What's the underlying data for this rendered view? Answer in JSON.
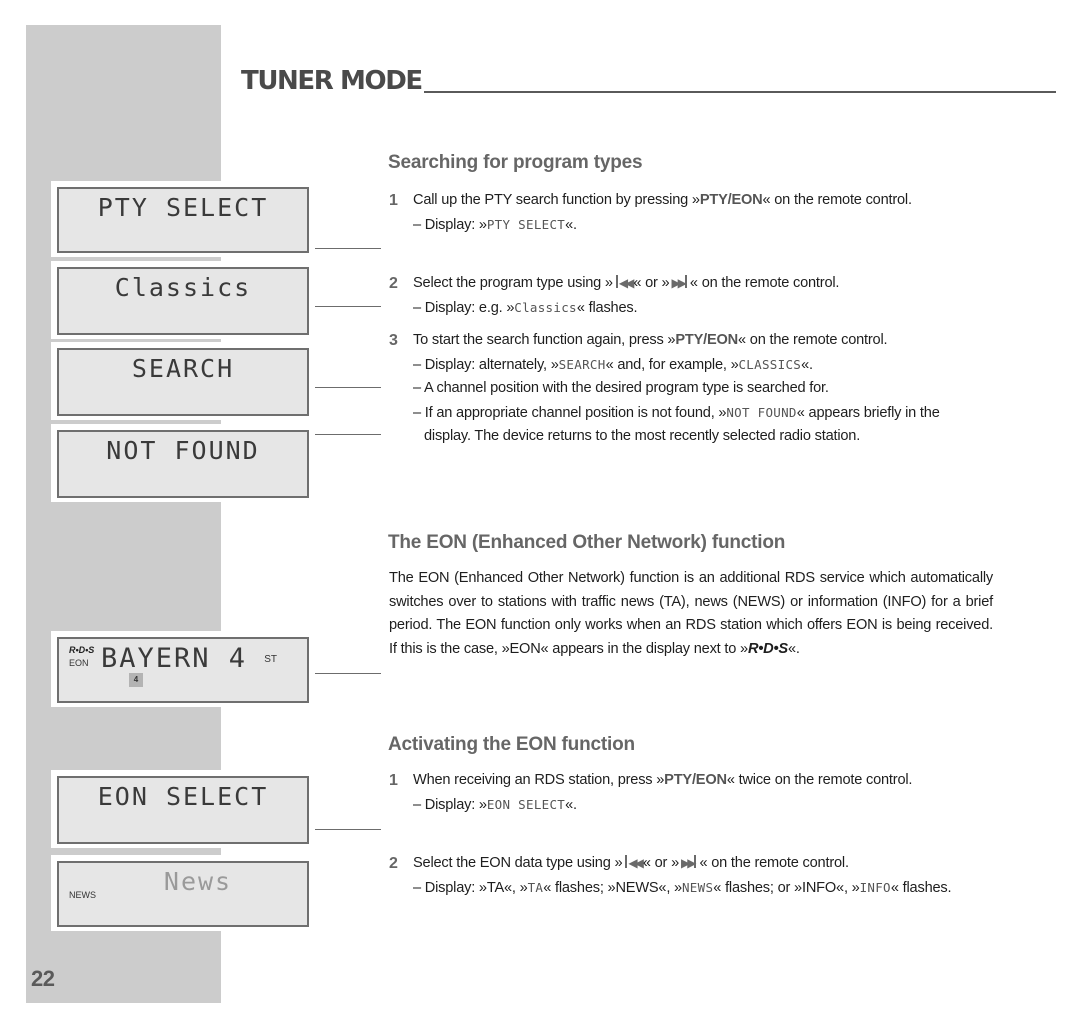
{
  "page": {
    "title": "TUNER MODE",
    "number": "22"
  },
  "displays": [
    {
      "id": "pty-select",
      "text": "PTY SELECT"
    },
    {
      "id": "classics",
      "text": "Classics"
    },
    {
      "id": "search",
      "text": "SEARCH"
    },
    {
      "id": "not-found",
      "text": "NOT FOUND"
    },
    {
      "id": "bayern",
      "text": "BAYERN 4",
      "logo": "R•D•S",
      "eon": "EON",
      "stereo": "ST",
      "preset": "4"
    },
    {
      "id": "eon-select",
      "text": "EON SELECT"
    },
    {
      "id": "news",
      "text": "News",
      "tag": "NEWS"
    }
  ],
  "sections": {
    "pty": {
      "heading": "Searching for program types",
      "steps": [
        {
          "num": "1",
          "pre": "Call up the PTY search function by pressing »",
          "key": "PTY/EON",
          "post": "« on the remote control.",
          "sub_pre": "– Display: »",
          "sub_mono": "PTY SELECT",
          "sub_post": "«."
        },
        {
          "num": "2",
          "pre": "Select the program type using »",
          "mid": "« or »",
          "post": "« on the remote control.",
          "sub_pre": "– Display: e.g. »",
          "sub_mono": "Classics",
          "sub_post": "« flashes."
        },
        {
          "num": "3",
          "pre": "To start the search function again, press »",
          "key": "PTY/EON",
          "post": "« on the remote control.",
          "sub1_pre": "– Display: alternately, »",
          "sub1_mono1": "SEARCH",
          "sub1_mid": "« and, for example, »",
          "sub1_mono2": "CLASSICS",
          "sub1_post": "«.",
          "sub2": "– A channel position with the desired program type is searched for.",
          "sub3_pre": "– If an appropriate channel position is not found, »",
          "sub3_mono": "NOT FOUND",
          "sub3_post": "« appears briefly in the display. The device returns to the most recently selected radio station."
        }
      ]
    },
    "eon": {
      "heading": "The EON (Enhanced Other Network) function",
      "body_pre": "The EON (Enhanced Other Network) function is an additional RDS service which automatically switches over to stations with traffic news (TA), news (NEWS) or information (INFO) for a brief period. The EON function only works when an RDS station which offers EON is being received. If this is the case, »EON« appears in the display next to »",
      "body_rds": "R•D•S",
      "body_post": "«."
    },
    "activate": {
      "heading": "Activating the EON function",
      "steps": [
        {
          "num": "1",
          "pre": "When receiving an RDS station, press »",
          "key": "PTY/EON",
          "post": "« twice on the remote control.",
          "sub_pre": "– Display: »",
          "sub_mono": "EON SELECT",
          "sub_post": "«."
        },
        {
          "num": "2",
          "pre": "Select the EON data type using »",
          "mid": "« or »",
          "post": "« on the remote control.",
          "sub_a": "– Display: »TA«, »",
          "sub_m1": "TA",
          "sub_b": "« flashes; »NEWS«, »",
          "sub_m2": "NEWS",
          "sub_c": "« flashes; or »INFO«, »",
          "sub_m3": "INFO",
          "sub_d": "« flashes."
        }
      ]
    }
  },
  "icons": {
    "prev": "skip-back-icon",
    "next": "skip-forward-icon"
  },
  "colors": {
    "sidebar": "#cccccc",
    "lcd": "#e6e6e6",
    "heading": "#666666"
  }
}
